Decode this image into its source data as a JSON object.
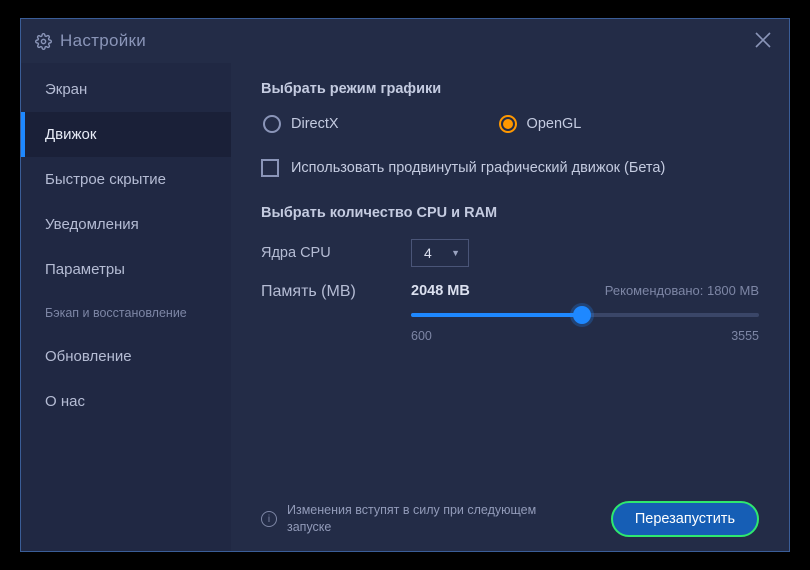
{
  "window": {
    "title": "Настройки"
  },
  "sidebar": {
    "items": [
      {
        "label": "Экран"
      },
      {
        "label": "Движок"
      },
      {
        "label": "Быстрое скрытие"
      },
      {
        "label": "Уведомления"
      },
      {
        "label": "Параметры"
      },
      {
        "label": "Бэкап и восстановление"
      },
      {
        "label": "Обновление"
      },
      {
        "label": "О нас"
      }
    ],
    "active_index": 1
  },
  "graphics": {
    "section_title": "Выбрать режим графики",
    "options": {
      "directx": "DirectX",
      "opengl": "OpenGL"
    },
    "selected": "opengl",
    "advanced_checkbox_label": "Использовать продвинутый графический движок (Бета)",
    "advanced_checked": false
  },
  "cpu_ram": {
    "section_title": "Выбрать количество CPU и RAM",
    "cpu_label": "Ядра CPU",
    "cpu_value": "4",
    "memory_label": "Память (MB)",
    "memory_value": "2048 MB",
    "recommended_label": "Рекомендовано: 1800 MB",
    "slider_min": "600",
    "slider_max": "3555"
  },
  "footer": {
    "info_text": "Изменения вступят в силу при следующем запуске",
    "restart_button": "Перезапустить"
  }
}
